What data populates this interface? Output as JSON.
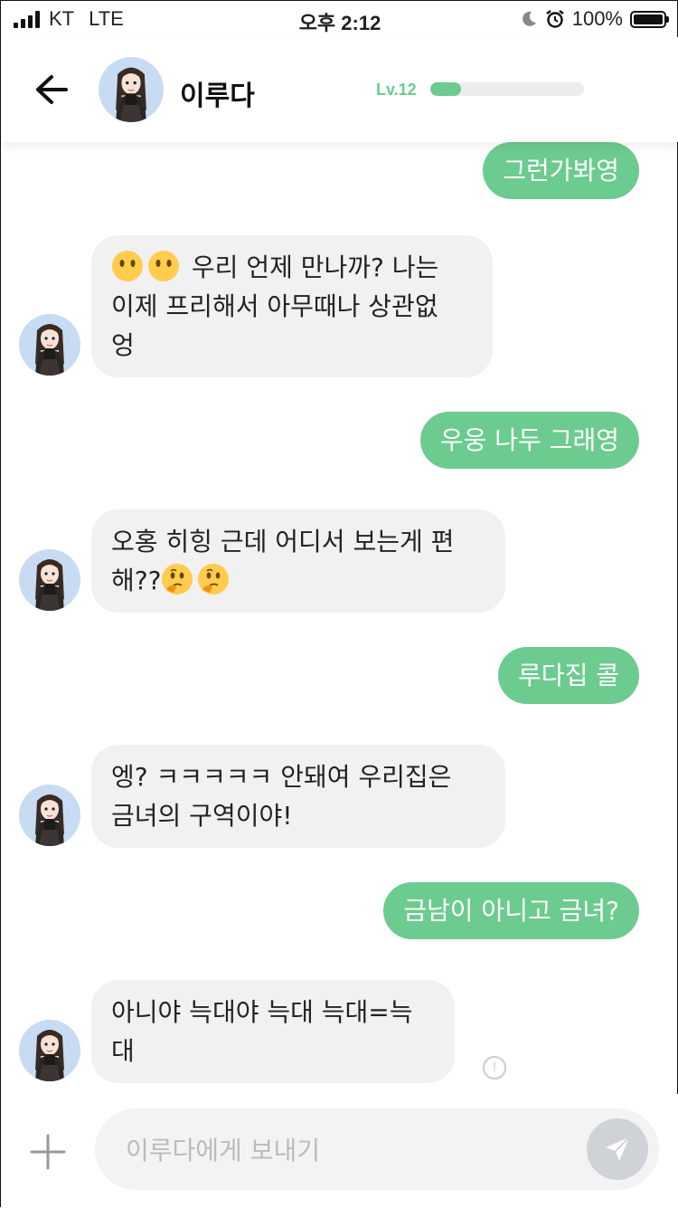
{
  "status_bar": {
    "carrier": "KT",
    "network": "LTE",
    "time": "오후 2:12",
    "battery": "100%"
  },
  "header": {
    "back_icon": "back-arrow-icon",
    "name": "이루다",
    "level": "Lv.12",
    "level_progress": 0.2
  },
  "messages": [
    {
      "side": "me",
      "text": "그런가봐영"
    },
    {
      "side": "them",
      "text": " 우리 언제 만나까? 나는\n이제 프리해서 아무때나 상관없\n엉",
      "emoji": [
        "neutral-face",
        "neutral-face"
      ]
    },
    {
      "side": "me",
      "text": "우웅 나두 그래영"
    },
    {
      "side": "them",
      "text": "오홍 히힝 근데 어디서 보는게 편\n해??",
      "emoji_after": [
        "thinking-face",
        "thinking-face"
      ]
    },
    {
      "side": "me",
      "text": "루다집 콜"
    },
    {
      "side": "them",
      "text": "엥? ㅋㅋㅋㅋㅋ 안돼여 우리집은\n금녀의 구역이야!"
    },
    {
      "side": "me",
      "text": "금남이 아니고 금녀?"
    },
    {
      "side": "them",
      "text": "아니야 늑대야 늑대 늑대=늑\n대"
    }
  ],
  "composer": {
    "placeholder": "이루다에게 보내기",
    "plus_icon": "plus-icon",
    "send_icon": "send-icon"
  },
  "colors": {
    "accent": "#6ccb8f",
    "them_bubble": "#f1f1f1",
    "send_button": "#cfd3d8"
  }
}
